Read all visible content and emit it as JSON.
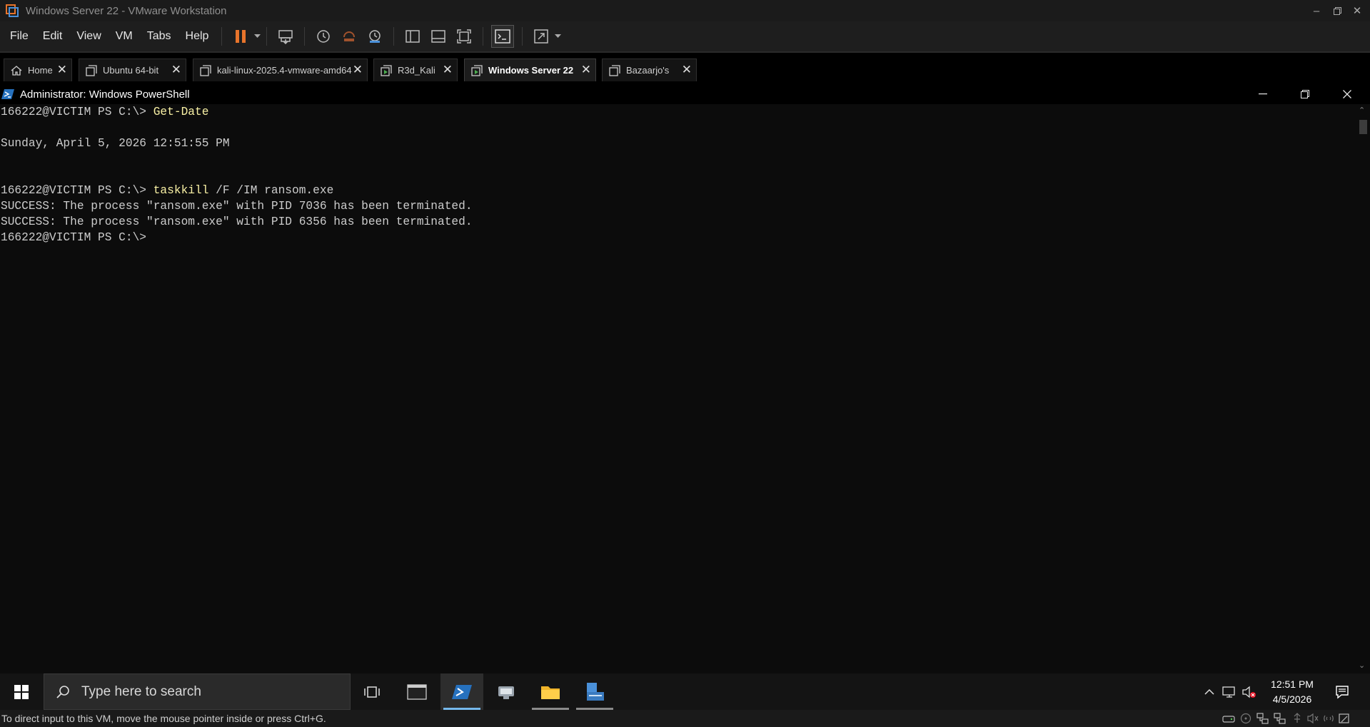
{
  "vmware": {
    "window_title": "Windows Server 22 - VMware Workstation",
    "menu": [
      "File",
      "Edit",
      "View",
      "VM",
      "Tabs",
      "Help"
    ],
    "tabs": [
      {
        "label": "Home",
        "active": false
      },
      {
        "label": "Ubuntu 64-bit",
        "active": false
      },
      {
        "label": "kali-linux-2025.4-vmware-amd64",
        "active": false
      },
      {
        "label": "R3d_Kali",
        "active": false
      },
      {
        "label": "Windows Server 22",
        "active": true
      },
      {
        "label": "Bazaarjo's",
        "active": false
      }
    ],
    "status_text": "To direct input to this VM, move the mouse pointer inside or press Ctrl+G.",
    "accent_color": "#e8742b"
  },
  "powershell": {
    "title": "Administrator: Windows PowerShell",
    "lines": {
      "l1_prompt": "166222@VICTIM PS C:\\> ",
      "l1_cmd": "Get-Date",
      "l2": "Sunday, April 5, 2026 12:51:55 PM",
      "l3_prompt": "166222@VICTIM PS C:\\> ",
      "l3_cmd": "taskkill",
      "l3_args": " /F /IM ransom.exe",
      "l4": "SUCCESS: The process \"ransom.exe\" with PID 7036 has been terminated.",
      "l5": "SUCCESS: The process \"ransom.exe\" with PID 6356 has been terminated.",
      "l6": "166222@VICTIM PS C:\\>"
    }
  },
  "taskbar": {
    "search_placeholder": "Type here to search",
    "time": "12:51 PM",
    "date": "4/5/2026"
  }
}
